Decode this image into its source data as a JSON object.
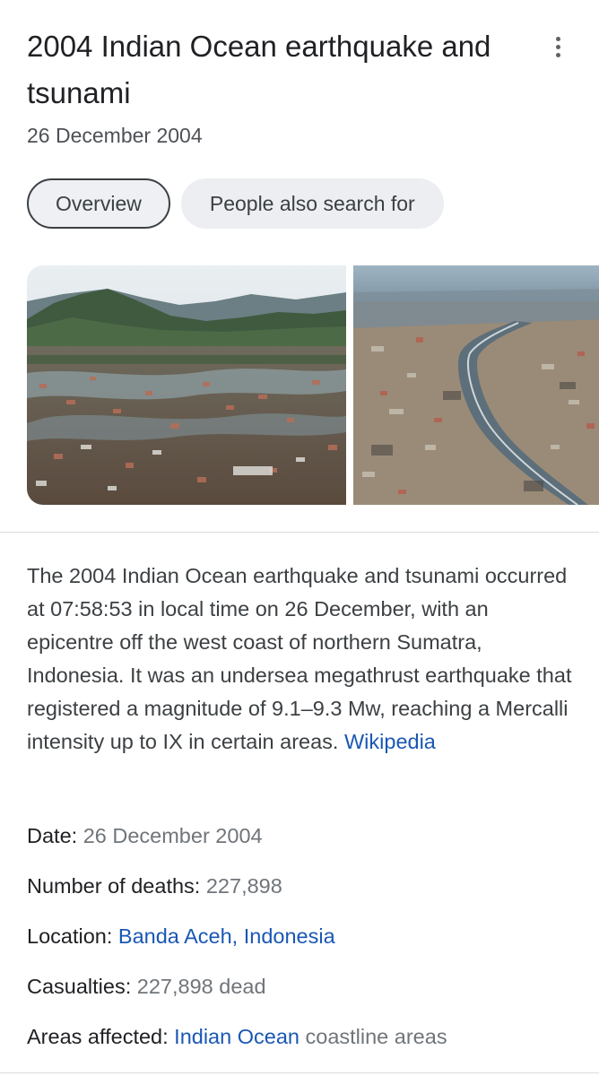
{
  "header": {
    "title": "2004 Indian Ocean earthquake and tsunami",
    "subtitle": "26 December 2004",
    "more_icon": "more-vert-icon"
  },
  "tabs": [
    {
      "label": "Overview",
      "active": true
    },
    {
      "label": "People also search for",
      "active": false
    }
  ],
  "description": {
    "text": "The 2004 Indian Ocean earthquake and tsunami occurred at 07:58:53 in local time on 26 December, with an epicentre off the west coast of northern Sumatra, Indonesia. It was an undersea megathrust earthquake that registered a magnitude of 9.1–9.3 Mw, reaching a Mercalli intensity up to IX in certain areas.",
    "source_link": "Wikipedia"
  },
  "facts": {
    "date": {
      "label": "Date",
      "value": "26 December 2004"
    },
    "deaths": {
      "label": "Number of deaths",
      "value": "227,898"
    },
    "location": {
      "label": "Location",
      "value": "Banda Aceh, Indonesia"
    },
    "casualties": {
      "label": "Casualties",
      "value": "227,898 dead"
    },
    "areas": {
      "label": "Areas affected",
      "link": "Indian Ocean",
      "value": "coastline areas"
    }
  },
  "colors": {
    "link": "#1a57b5",
    "text": "#202124",
    "muted": "#70757a",
    "chip_bg": "#eceef1"
  }
}
